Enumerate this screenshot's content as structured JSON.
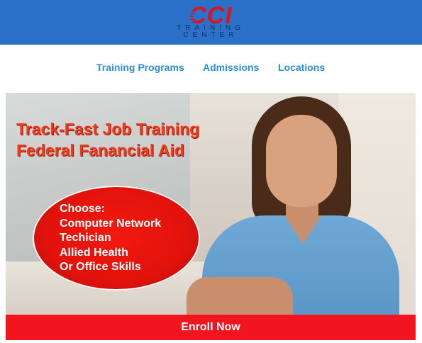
{
  "header": {
    "logo": {
      "letters": "CCI",
      "line1": "TRAINING",
      "line2": "CENTER"
    }
  },
  "nav": {
    "items": [
      {
        "label": "Training Programs"
      },
      {
        "label": "Admissions"
      },
      {
        "label": "Locations"
      }
    ]
  },
  "hero": {
    "headline_line1": "Track-Fast Job Training",
    "headline_line2": "Federal Fanancial Aid",
    "choose_lines": [
      "Choose:",
      "Computer Network",
      "Techician",
      "Allied Health",
      "Or Office Skills"
    ]
  },
  "cta": {
    "label": "Enroll Now"
  },
  "colors": {
    "header_bg": "#2b70c9",
    "nav_link": "#2b8fd0",
    "accent_red": "#f2141e",
    "headline_red": "#f03a1c"
  }
}
